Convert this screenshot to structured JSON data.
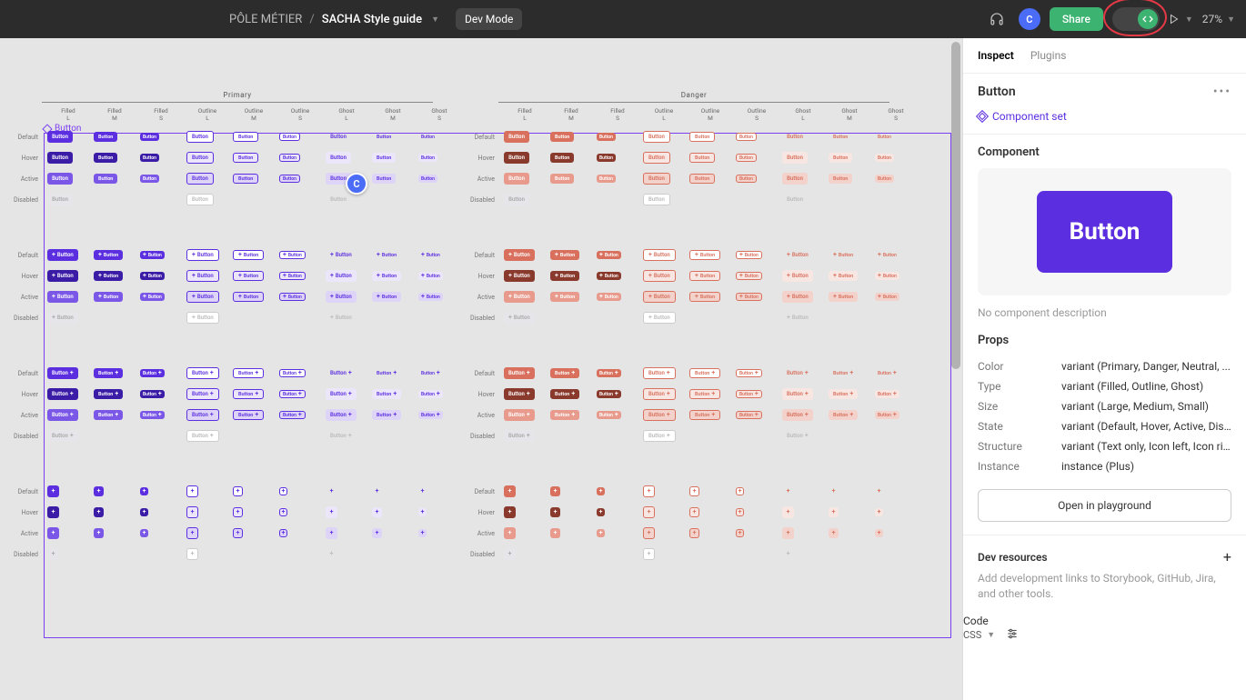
{
  "topbar": {
    "org": "PÔLE MÉTIER",
    "sep": "/",
    "file": "SACHA Style guide",
    "devmode": "Dev Mode",
    "share": "Share",
    "avatar": "C",
    "zoom": "27%"
  },
  "sidebar": {
    "tabs": {
      "inspect": "Inspect",
      "plugins": "Plugins"
    },
    "title": "Button",
    "component_set": "Component set",
    "section_component": "Component",
    "preview_label": "Button",
    "no_desc": "No component description",
    "props_title": "Props",
    "props": [
      {
        "k": "Color",
        "v": "variant (Primary, Danger, Neutral, ..."
      },
      {
        "k": "Type",
        "v": "variant (Filled, Outline, Ghost)"
      },
      {
        "k": "Size",
        "v": "variant (Large, Medium, Small)"
      },
      {
        "k": "State",
        "v": "variant (Default, Hover, Active, Dis..."
      },
      {
        "k": "Structure",
        "v": "variant (Text only, Icon left, Icon rig..."
      },
      {
        "k": "Instance",
        "v": "instance (Plus)"
      }
    ],
    "open_playground": "Open in playground",
    "dev_resources": "Dev resources",
    "dev_hint": "Add development links to Storybook, GitHub, Jira, and other tools.",
    "code": "Code",
    "css": "CSS"
  },
  "canvas": {
    "frame_label": "Button",
    "color_heads": {
      "primary": "Primary",
      "danger": "Danger"
    },
    "col_heads": [
      "Filled\nL",
      "Filled\nM",
      "Filled\nS",
      "Outline\nL",
      "Outline\nM",
      "Outline\nS",
      "Ghost\nL",
      "Ghost\nM",
      "Ghost\nS"
    ],
    "states": [
      "Default",
      "Hover",
      "Active",
      "Disabled"
    ],
    "btn_label": "Button",
    "cursor": "C"
  }
}
